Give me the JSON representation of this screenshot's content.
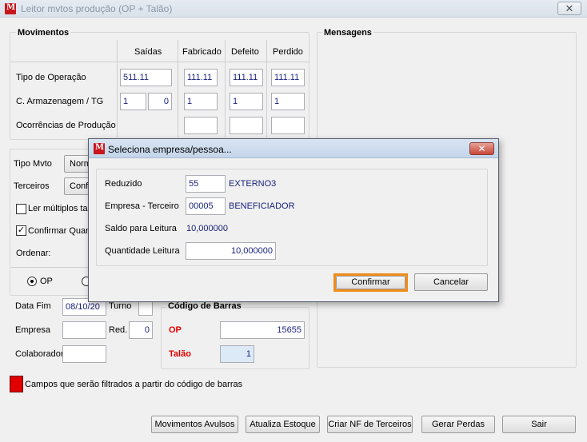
{
  "window": {
    "title": "Leitor mvtos produção (OP + Talão)",
    "close_glyph": "✕",
    "icon_letter": "M"
  },
  "movimentos": {
    "title": "Movimentos",
    "columns": [
      "Saídas",
      "Fabricado",
      "Defeito",
      "Perdido"
    ],
    "rows": {
      "tipo_operacao": {
        "label": "Tipo de Operação",
        "saidas": "511.11",
        "fabricado": "111.11",
        "defeito": "111.11",
        "perdido": "111.11"
      },
      "armazenagem": {
        "label": "C. Armazenagem / TG",
        "saidas_a": "1",
        "saidas_b": "0",
        "fabricado": "1",
        "defeito": "1",
        "perdido": "1"
      },
      "ocorrencias": {
        "label": "Ocorrências de Produção",
        "fabricado": "",
        "defeito": "",
        "perdido": ""
      }
    }
  },
  "mensagens": {
    "title": "Mensagens"
  },
  "opcoes": {
    "tipo_mvto": {
      "label": "Tipo Mvto",
      "value": "Norm"
    },
    "terceiros": {
      "label": "Terceiros",
      "value": "Confo"
    },
    "ler_multiplos": {
      "label": "Ler múltiplos talo",
      "checked": false
    },
    "confirmar": {
      "label": "Confirmar Quan",
      "checked": true,
      "check_glyph": "✓"
    },
    "ordenar": {
      "label": "Ordenar:"
    },
    "radio_op": {
      "label": "OP",
      "selected": true
    }
  },
  "filtros": {
    "data_fim": {
      "label": "Data Fim",
      "value": "08/10/20"
    },
    "turno": {
      "label": "Turno",
      "value": ""
    },
    "empresa": {
      "label": "Empresa",
      "value": ""
    },
    "red": {
      "label": "Red.",
      "value": "0"
    },
    "colaborador": {
      "label": "Colaborador",
      "value": ""
    }
  },
  "codigo_barras": {
    "title": "Código de Barras",
    "op": {
      "label": "OP",
      "value": "15655"
    },
    "talao": {
      "label": "Talão",
      "value": "1"
    }
  },
  "legend": {
    "text": "Campos que serão filtrados a partir do código de barras",
    "color": "#e00000"
  },
  "buttons": {
    "movimentos_avulsos": "Movimentos Avulsos",
    "atualiza_estoque": "Atualiza Estoque",
    "criar_nf": "Criar NF de Terceiros",
    "gerar_perdas": "Gerar Perdas",
    "sair": "Sair"
  },
  "dialog": {
    "title": "Seleciona empresa/pessoa...",
    "close_glyph": "✕",
    "reduzido": {
      "label": "Reduzido",
      "value": "55",
      "desc": "EXTERNO3"
    },
    "empresa_terceiro": {
      "label": "Empresa - Terceiro",
      "value": "00005",
      "desc": "BENEFICIADOR"
    },
    "saldo_leitura": {
      "label": "Saldo para Leitura",
      "value": "10,000000"
    },
    "quantidade_leitura": {
      "label": "Quantidade Leitura",
      "value": "10,000000"
    },
    "confirmar_label": "Confirmar",
    "cancelar_label": "Cancelar",
    "focus_color": "#f08c1a"
  }
}
